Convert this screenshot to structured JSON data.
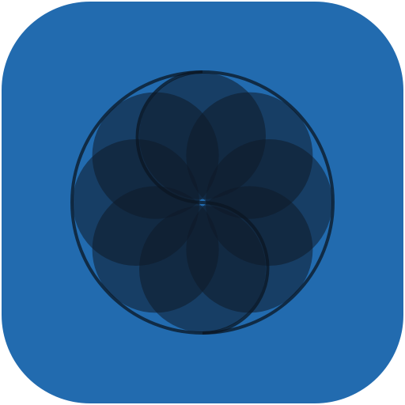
{
  "app_icon": {
    "icon_name": "sequel-pro-logo-icon",
    "background_color": "#226BAF",
    "petal_color": "#0E1A28",
    "petal_opacity": 0.55,
    "outline_color": "#0B1622",
    "petal_count": 8
  }
}
